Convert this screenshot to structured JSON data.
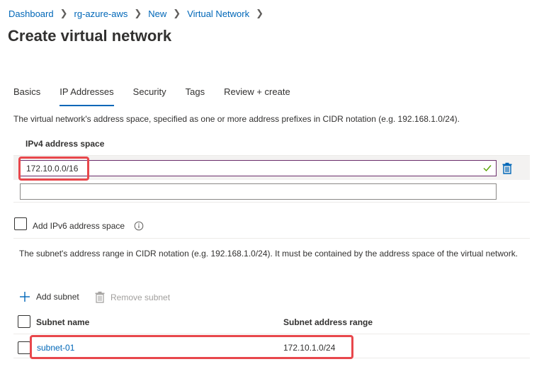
{
  "breadcrumb": {
    "items": [
      "Dashboard",
      "rg-azure-aws",
      "New",
      "Virtual Network"
    ]
  },
  "page": {
    "title": "Create virtual network"
  },
  "tabs": [
    {
      "label": "Basics",
      "active": false
    },
    {
      "label": "IP Addresses",
      "active": true
    },
    {
      "label": "Security",
      "active": false
    },
    {
      "label": "Tags",
      "active": false
    },
    {
      "label": "Review + create",
      "active": false
    }
  ],
  "ip_addresses": {
    "description": "The virtual network's address space, specified as one or more address prefixes in CIDR notation (e.g. 192.168.1.0/24).",
    "ipv4_label": "IPv4 address space",
    "ipv4_values": [
      "172.10.0.0/16",
      ""
    ],
    "ipv6_checkbox_label": "Add IPv6 address space",
    "ipv6_checked": false,
    "subnet_description": "The subnet's address range in CIDR notation (e.g. 192.168.1.0/24). It must be contained by the address space of the virtual network."
  },
  "subnet_toolbar": {
    "add_label": "Add subnet",
    "remove_label": "Remove subnet"
  },
  "subnet_table": {
    "columns": [
      "Subnet name",
      "Subnet address range"
    ],
    "rows": [
      {
        "name": "subnet-01",
        "range": "172.10.1.0/24"
      }
    ]
  },
  "colors": {
    "link": "#0067b8",
    "highlight": "#e8474c",
    "valid_check": "#57a300"
  },
  "icons": [
    "chevron-right-icon",
    "checkmark-icon",
    "trash-icon",
    "info-icon",
    "plus-icon"
  ]
}
